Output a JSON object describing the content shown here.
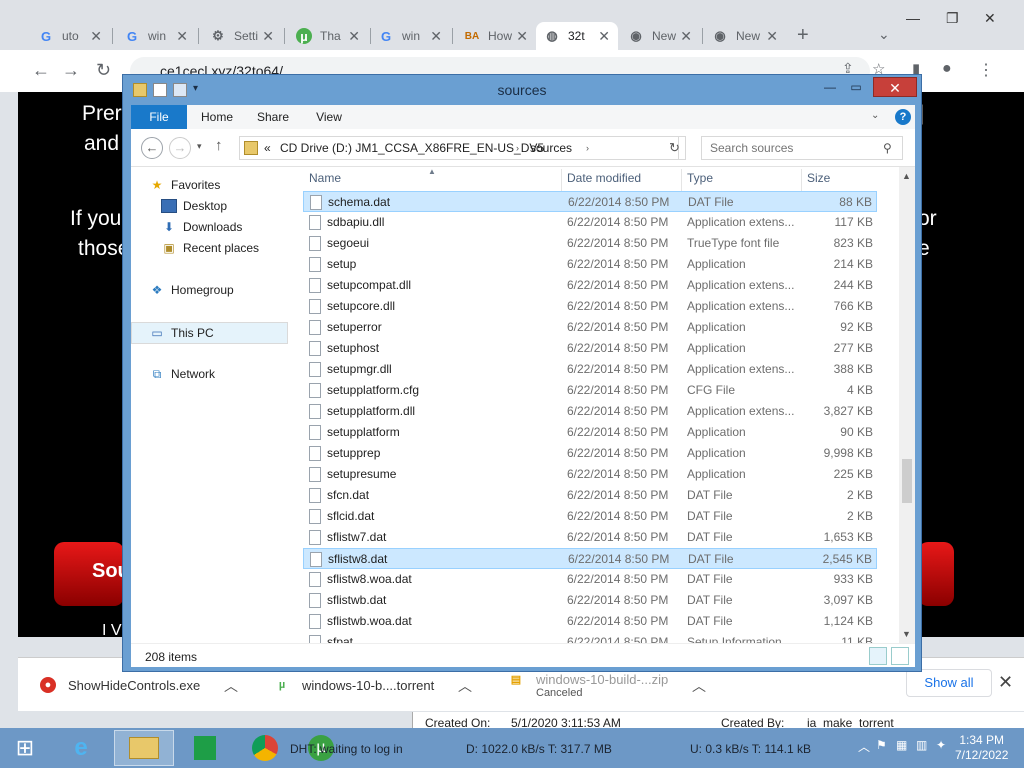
{
  "browser": {
    "tabs": [
      {
        "label": "uto",
        "icon": "google-icon"
      },
      {
        "label": "win",
        "icon": "google-icon"
      },
      {
        "label": "Setti",
        "icon": "gear-icon"
      },
      {
        "label": "Tha",
        "icon": "utorrent-icon"
      },
      {
        "label": "win",
        "icon": "google-icon"
      },
      {
        "label": "How",
        "icon": "ba-icon"
      },
      {
        "label": "32t",
        "icon": "globe-icon"
      },
      {
        "label": "New",
        "icon": "chrome-icon"
      },
      {
        "label": "New",
        "icon": "chrome-icon"
      }
    ],
    "new_tab": "+",
    "address": "ce1cecl.xyz/32to64/"
  },
  "page": {
    "line1": "Prere",
    "line2": "and",
    "line3": "If you",
    "line4": "those",
    "right1": "]",
    "right2": "or",
    "right3": "e",
    "button_fragment": "Sou",
    "bottom_fragment": "I V"
  },
  "explorer": {
    "title": "sources",
    "ribbon_tabs": [
      "File",
      "Home",
      "Share",
      "View"
    ],
    "path": [
      "CD Drive (D:) JM1_CCSA_X86FRE_EN-US_DV5",
      "sources"
    ],
    "path_prefix": "«",
    "search_placeholder": "Search sources",
    "nav": {
      "favorites": "Favorites",
      "desktop": "Desktop",
      "downloads": "Downloads",
      "recent": "Recent places",
      "homegroup": "Homegroup",
      "thispc": "This PC",
      "network": "Network"
    },
    "columns": {
      "name": "Name",
      "date": "Date modified",
      "type": "Type",
      "size": "Size"
    },
    "files": [
      {
        "name": "schema.dat",
        "date": "6/22/2014 8:50 PM",
        "type": "DAT File",
        "size": "88 KB",
        "selected": true
      },
      {
        "name": "sdbapiu.dll",
        "date": "6/22/2014 8:50 PM",
        "type": "Application extens...",
        "size": "117 KB"
      },
      {
        "name": "segoeui",
        "date": "6/22/2014 8:50 PM",
        "type": "TrueType font file",
        "size": "823 KB"
      },
      {
        "name": "setup",
        "date": "6/22/2014 8:50 PM",
        "type": "Application",
        "size": "214 KB"
      },
      {
        "name": "setupcompat.dll",
        "date": "6/22/2014 8:50 PM",
        "type": "Application extens...",
        "size": "244 KB"
      },
      {
        "name": "setupcore.dll",
        "date": "6/22/2014 8:50 PM",
        "type": "Application extens...",
        "size": "766 KB"
      },
      {
        "name": "setuperror",
        "date": "6/22/2014 8:50 PM",
        "type": "Application",
        "size": "92 KB"
      },
      {
        "name": "setuphost",
        "date": "6/22/2014 8:50 PM",
        "type": "Application",
        "size": "277 KB"
      },
      {
        "name": "setupmgr.dll",
        "date": "6/22/2014 8:50 PM",
        "type": "Application extens...",
        "size": "388 KB"
      },
      {
        "name": "setupplatform.cfg",
        "date": "6/22/2014 8:50 PM",
        "type": "CFG File",
        "size": "4 KB"
      },
      {
        "name": "setupplatform.dll",
        "date": "6/22/2014 8:50 PM",
        "type": "Application extens...",
        "size": "3,827 KB"
      },
      {
        "name": "setupplatform",
        "date": "6/22/2014 8:50 PM",
        "type": "Application",
        "size": "90 KB"
      },
      {
        "name": "setupprep",
        "date": "6/22/2014 8:50 PM",
        "type": "Application",
        "size": "9,998 KB"
      },
      {
        "name": "setupresume",
        "date": "6/22/2014 8:50 PM",
        "type": "Application",
        "size": "225 KB"
      },
      {
        "name": "sfcn.dat",
        "date": "6/22/2014 8:50 PM",
        "type": "DAT File",
        "size": "2 KB"
      },
      {
        "name": "sflcid.dat",
        "date": "6/22/2014 8:50 PM",
        "type": "DAT File",
        "size": "2 KB"
      },
      {
        "name": "sflistw7.dat",
        "date": "6/22/2014 8:50 PM",
        "type": "DAT File",
        "size": "1,653 KB"
      },
      {
        "name": "sflistw8.dat",
        "date": "6/22/2014 8:50 PM",
        "type": "DAT File",
        "size": "2,545 KB",
        "hovered": true
      },
      {
        "name": "sflistw8.woa.dat",
        "date": "6/22/2014 8:50 PM",
        "type": "DAT File",
        "size": "933 KB"
      },
      {
        "name": "sflistwb.dat",
        "date": "6/22/2014 8:50 PM",
        "type": "DAT File",
        "size": "3,097 KB"
      },
      {
        "name": "sflistwb.woa.dat",
        "date": "6/22/2014 8:50 PM",
        "type": "DAT File",
        "size": "1,124 KB"
      },
      {
        "name": "sfpat",
        "date": "6/22/2014 8:50 PM",
        "type": "Setup Information",
        "size": "11 KB"
      }
    ],
    "item_count": "208 items"
  },
  "downloads": {
    "items": [
      {
        "name": "ShowHideControls.exe",
        "status": ""
      },
      {
        "name": "windows-10-b....torrent",
        "status": ""
      },
      {
        "name": "windows-10-build-...zip",
        "status": "Canceled"
      }
    ],
    "show_all": "Show all"
  },
  "torrent": {
    "created_on_label": "Created On:",
    "created_on": "5/1/2020 3:11:53 AM",
    "created_by_label": "Created By:",
    "created_by": "ia_make_torrent"
  },
  "taskbar": {
    "utorrent_status": "DHT: waiting to log in",
    "download": "D: 1022.0 kB/s T: 317.7 MB",
    "upload": "U: 0.3 kB/s T: 114.1 kB",
    "time": "1:34 PM",
    "date": "7/12/2022"
  }
}
